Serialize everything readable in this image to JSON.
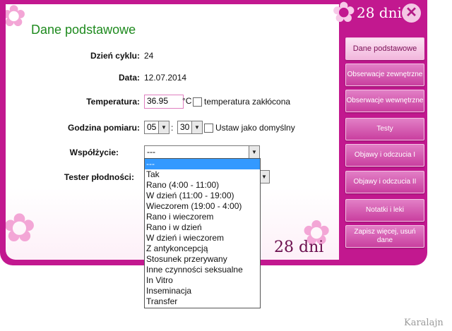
{
  "app": {
    "logo_text": "28 dni"
  },
  "page_title": "Dane podstawowe",
  "form": {
    "cycle_day_label": "Dzień cyklu:",
    "cycle_day_value": "24",
    "date_label": "Data:",
    "date_value": "12.07.2014",
    "temperature_label": "Temperatura:",
    "temperature_value": "36.95",
    "temperature_unit": "°C",
    "temperature_disturbed_label": "temperatura zakłócona",
    "measure_time_label": "Godzina pomiaru:",
    "hour_value": "05",
    "minute_value": "30",
    "time_separator": ":",
    "set_default_label": "Ustaw jako domyślny",
    "intercourse_label": "Współżycie:",
    "intercourse_value": "---",
    "fertility_tester_label": "Tester płodności:"
  },
  "intercourse_options": [
    "---",
    "Tak",
    "Rano (4:00 - 11:00)",
    "W dzień (11:00 - 19:00)",
    "Wieczorem (19:00 - 4:00)",
    "Rano i wieczorem",
    "Rano i w dzień",
    "W dzień i wieczorem",
    "Z antykoncepcją",
    "Stosunek przerywany",
    "Inne czynności seksualne",
    "In Vitro",
    "Inseminacja",
    "Transfer"
  ],
  "sidebar": {
    "items": [
      {
        "label": "Dane podstawowe",
        "active": true
      },
      {
        "label": "Obserwacje zewnętrzne",
        "active": false
      },
      {
        "label": "Obserwacje wewnętrzne",
        "active": false
      },
      {
        "label": "Testy",
        "active": false
      },
      {
        "label": "Objawy i odczucia I",
        "active": false
      },
      {
        "label": "Objawy i odczucia II",
        "active": false
      },
      {
        "label": "Notatki i leki",
        "active": false
      },
      {
        "label": "Zapisz więcej, usuń dane",
        "active": false
      }
    ]
  },
  "close_icon_glyph": "✕",
  "watermark": "Karalajn",
  "colors": {
    "frame": "#c2188f",
    "title_green": "#1e8a1e",
    "selected_option": "#3399ff"
  }
}
